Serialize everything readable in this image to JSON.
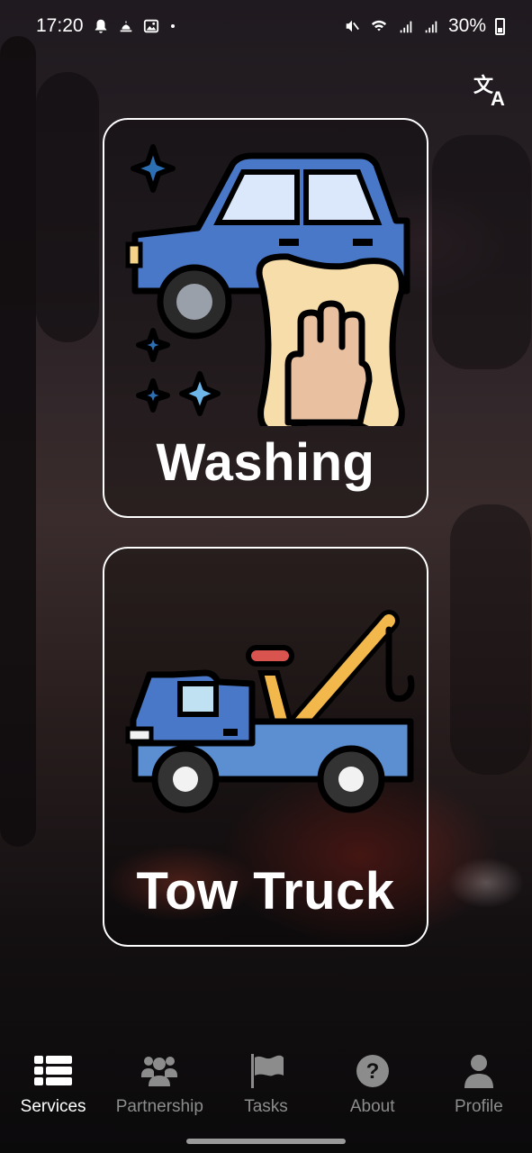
{
  "status_bar": {
    "time": "17:20",
    "battery": "30%"
  },
  "header": {
    "translate_icon": "translate-icon"
  },
  "services": [
    {
      "label": "Washing",
      "icon": "car-wash-icon"
    },
    {
      "label": "Tow Truck",
      "icon": "tow-truck-icon"
    }
  ],
  "nav": {
    "items": [
      {
        "label": "Services",
        "icon": "list-icon",
        "active": true
      },
      {
        "label": "Partnership",
        "icon": "group-icon",
        "active": false
      },
      {
        "label": "Tasks",
        "icon": "flag-icon",
        "active": false
      },
      {
        "label": "About",
        "icon": "question-icon",
        "active": false
      },
      {
        "label": "Profile",
        "icon": "user-icon",
        "active": false
      }
    ]
  },
  "colors": {
    "active_nav": "#ffffff",
    "inactive_nav": "#8c8c8c",
    "card_border": "#ffffff"
  }
}
